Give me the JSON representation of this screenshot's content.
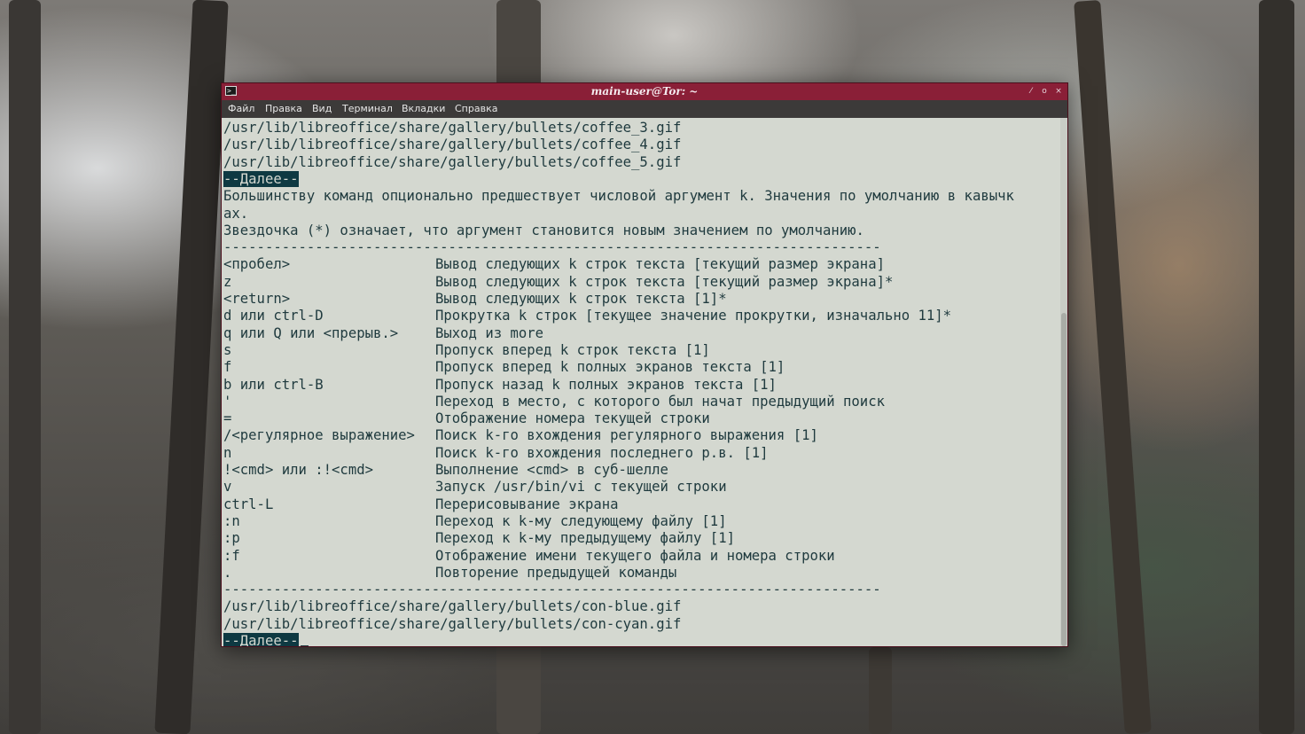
{
  "window": {
    "title": "main-user@Tor: ~",
    "icon": "terminal-icon",
    "buttons": {
      "minimize": "⁄",
      "maximize": "o",
      "close": "×"
    }
  },
  "menu": [
    "Файл",
    "Правка",
    "Вид",
    "Терминал",
    "Вкладки",
    "Справка"
  ],
  "terminal": {
    "top_lines": [
      "/usr/lib/libreoffice/share/gallery/bullets/coffee_3.gif",
      "/usr/lib/libreoffice/share/gallery/bullets/coffee_4.gif",
      "/usr/lib/libreoffice/share/gallery/bullets/coffee_5.gif"
    ],
    "more_prompt": "--Далее--",
    "intro": [
      "Большинству команд опционально предшествует числовой аргумент k. Значения по умолчанию в кавычк",
      "ах.",
      "Звездочка (*) означает, что аргумент становится новым значением по умолчанию."
    ],
    "separator": "-------------------------------------------------------------------------------",
    "commands": [
      {
        "key": "<пробел>",
        "desc": "Вывод следующих k строк текста [текущий размер экрана]"
      },
      {
        "key": "z",
        "desc": "Вывод следующих k строк текста [текущий размер экрана]*"
      },
      {
        "key": "<return>",
        "desc": "Вывод следующих k строк текста [1]*"
      },
      {
        "key": "d или ctrl-D",
        "desc": "Прокрутка k строк [текущее значение прокрутки, изначально 11]*"
      },
      {
        "key": "q или Q или <прерыв.>",
        "desc": "Выход из more"
      },
      {
        "key": "s",
        "desc": "Пропуск вперед k строк текста [1]"
      },
      {
        "key": "f",
        "desc": "Пропуск вперед k полных экранов текста [1]"
      },
      {
        "key": "b или ctrl-B",
        "desc": "Пропуск назад k полных экранов текста [1]"
      },
      {
        "key": "'",
        "desc": "Переход в место, с которого был начат предыдущий поиск"
      },
      {
        "key": "=",
        "desc": "Отображение номера текущей строки"
      },
      {
        "key": "/<регулярное выражение>",
        "desc": "Поиск k-го вхождения регулярного выражения [1]"
      },
      {
        "key": "n",
        "desc": "Поиск k-го вхождения последнего р.в. [1]"
      },
      {
        "key": "!<cmd> или :!<cmd>",
        "desc": "Выполнение <cmd> в суб-шелле"
      },
      {
        "key": "v",
        "desc": "Запуск /usr/bin/vi с текущей строки"
      },
      {
        "key": "ctrl-L",
        "desc": "Перерисовывание экрана"
      },
      {
        "key": ":n",
        "desc": "Переход к k-му следующему файлу [1]"
      },
      {
        "key": ":p",
        "desc": "Переход к k-му предыдущему файлу [1]"
      },
      {
        "key": ":f",
        "desc": "Отображение имени текущего файла и номера строки"
      },
      {
        "key": ".",
        "desc": "Повторение предыдущей команды"
      }
    ],
    "bottom_lines": [
      "/usr/lib/libreoffice/share/gallery/bullets/con-blue.gif",
      "/usr/lib/libreoffice/share/gallery/bullets/con-cyan.gif"
    ],
    "more_prompt_bottom": "--Далее--"
  },
  "colors": {
    "titlebar": "#8a1f37",
    "menubar": "#3c3a39",
    "terminal_bg": "#d4d8d0",
    "terminal_fg": "#1f3a3e",
    "highlight": "#0e3942"
  }
}
